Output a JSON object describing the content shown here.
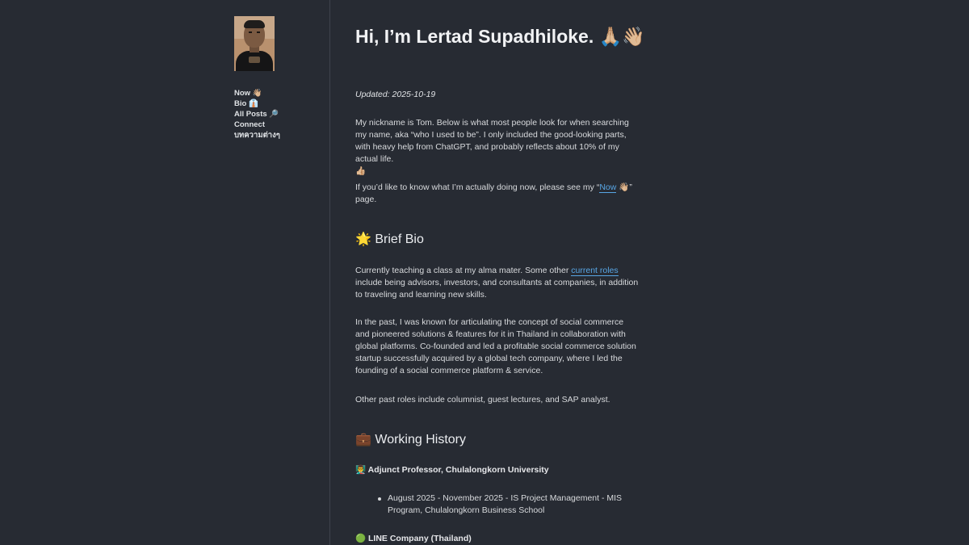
{
  "sidebar": {
    "avatar_alt": "Profile photo",
    "nav": [
      {
        "label": "Now",
        "emoji": "👋🏼"
      },
      {
        "label": "Bio",
        "emoji": "👔"
      },
      {
        "label": "All Posts",
        "emoji": "🔎"
      },
      {
        "label": "Connect",
        "emoji": ""
      },
      {
        "label": "บทความต่างๆ",
        "emoji": ""
      }
    ]
  },
  "content": {
    "title": "Hi, I’m Lertad Supadhiloke.",
    "title_emoji": "🙏🏼👋🏼",
    "updated": "Updated: 2025-10-19",
    "intro": "My nickname is Tom. Below is what most people look for when searching my name, aka “who I used to be”. I only included the good-looking parts, with heavy help from ChatGPT, and probably reflects about 10% of my actual life.",
    "intro_emoji": "👍🏼",
    "now_prefix": "If you’d like to know what I’m actually doing now, please see my “",
    "now_link": "Now",
    "now_link_emoji": "👋🏼",
    "now_suffix": "” page.",
    "brief_bio_heading": "Brief Bio",
    "brief_bio_emoji": "🌟",
    "bio_1_prefix": "Currently teaching a class at my alma mater. Some other ",
    "bio_1_link": "current roles",
    "bio_1_suffix": " include being advisors, investors, and consultants at companies, in addition to traveling and learning new skills.",
    "bio_2": "In the past, I was known for articulating the concept of social commerce and pioneered solutions & features for it in Thailand in collaboration with global platforms. Co-founded and led a profitable social commerce solution startup successfully acquired by a global tech company, where I led the founding of a social commerce platform & service.",
    "bio_3": "Other past roles include columnist, guest lectures, and SAP analyst.",
    "working_history_heading": "Working History",
    "working_history_emoji": "💼",
    "roles": [
      {
        "title": "Adjunct Professor, Chulalongkorn University",
        "emoji": "👨‍🏫",
        "items": [
          "August 2025 - November 2025 - IS Project Management - MIS Program, Chulalongkorn Business School"
        ]
      },
      {
        "title": "LINE Company (Thailand)",
        "emoji": "🟢",
        "items": []
      }
    ]
  }
}
